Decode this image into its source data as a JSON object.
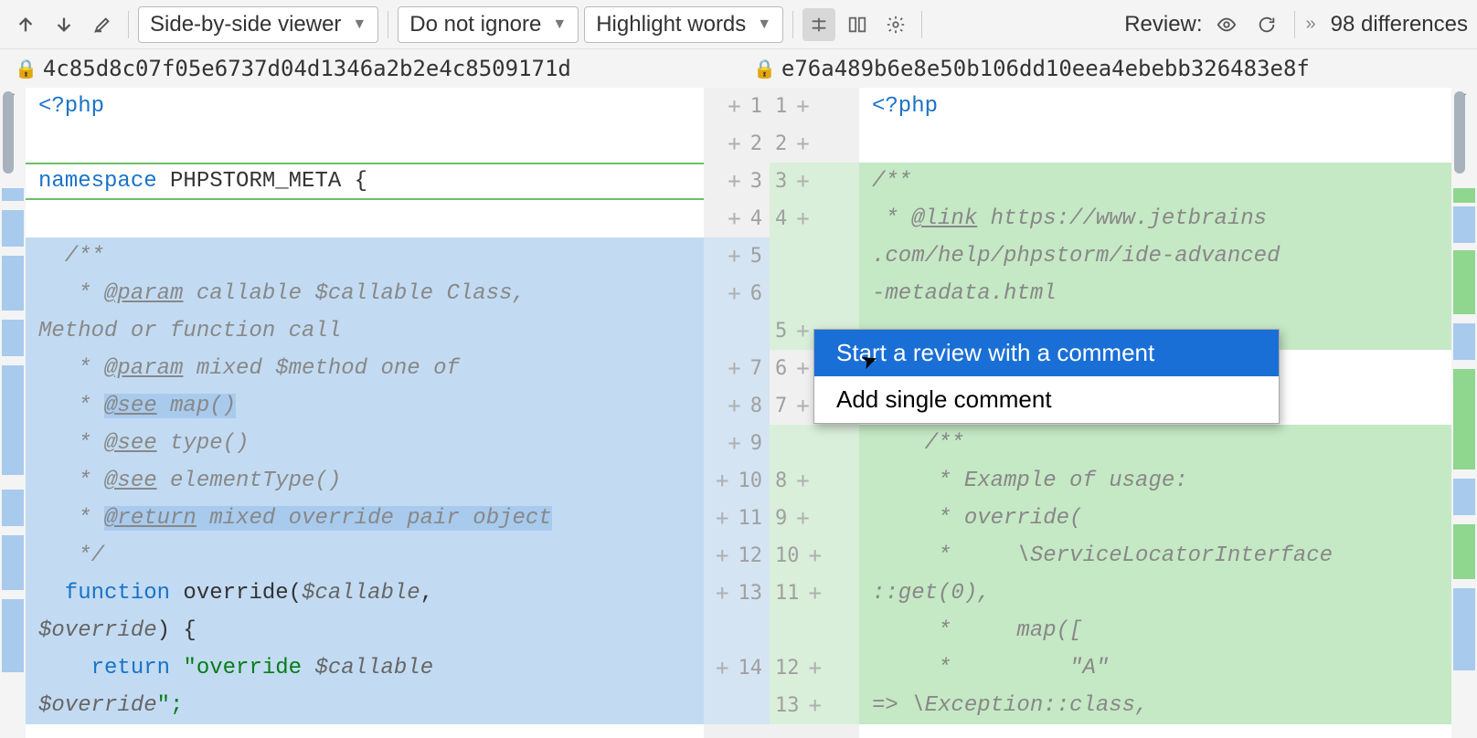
{
  "toolbar": {
    "viewer_mode": "Side-by-side viewer",
    "ignore_mode": "Do not ignore",
    "highlight_mode": "Highlight words",
    "review_label": "Review:",
    "diff_count": "98 differences"
  },
  "hashes": {
    "left": "4c85d8c07f05e6737d04d1346a2b2e4c8509171d",
    "right": "e76a489b6e8e50b106dd10eea4ebebb326483e8f"
  },
  "left_gutter": [
    "1",
    "2",
    "3",
    "4",
    "5",
    "6",
    "7",
    "8",
    "9",
    "10",
    "11",
    "12",
    "13",
    "14",
    ""
  ],
  "right_gutter": [
    "1",
    "2",
    "3",
    "4",
    "",
    "5",
    "6",
    "7",
    "",
    "8",
    "9",
    "10",
    "11",
    "12",
    "13",
    ""
  ],
  "left_code": {
    "l1_tag": "<?php",
    "l3_kw": "namespace",
    "l3_name": " PHPSTORM_META {",
    "l5": "  /**",
    "l6a": "   * ",
    "l6b": "@param",
    "l6c": " callable $callable Class,",
    "l6d": "Method or function call",
    "l7a": "   * ",
    "l7b": "@param",
    "l7c": " mixed $method one of",
    "l8a": "   * ",
    "l8b": "@see",
    "l8c": " map()",
    "l9a": "   * ",
    "l9b": "@see",
    "l9c": " type()",
    "l10a": "   * ",
    "l10b": "@see",
    "l10c": " elementType()",
    "l11a": "   * ",
    "l11b": "@return",
    "l11c": " mixed override pair object",
    "l12": "   */",
    "l13_kw": "  function",
    "l13_name": " override(",
    "l13_var": "$callable",
    "l13_c": ", ",
    "l13_var2": "$override",
    "l13_end": ") {",
    "l14_kw": "    return ",
    "l14_str": "\"override ",
    "l14_var": "$callable ",
    "l14_var2": "$override",
    "l14_end": "\";"
  },
  "right_code": {
    "r1_tag": "<?php",
    "r3": "/**",
    "r4a": " * ",
    "r4b": "@link",
    "r4c": " https://www.jetbrains",
    "r4d": ".com/help/phpstorm/ide-advanced",
    "r4e": "-metadata.html",
    "r8": "    /**",
    "r9": "     * Example of usage:",
    "r10": "     * override(",
    "r11": "     *     \\ServiceLocatorInterface",
    "r11b": "::get(0),",
    "r12": "     *     map([",
    "r13a": "     *         ",
    "r13b": "\"A\"",
    "r14a": "=> \\",
    "r14b": "Exception",
    "r14c": "::class,"
  },
  "context_menu": {
    "start_review": "Start a review with a comment",
    "add_comment": "Add single comment"
  }
}
